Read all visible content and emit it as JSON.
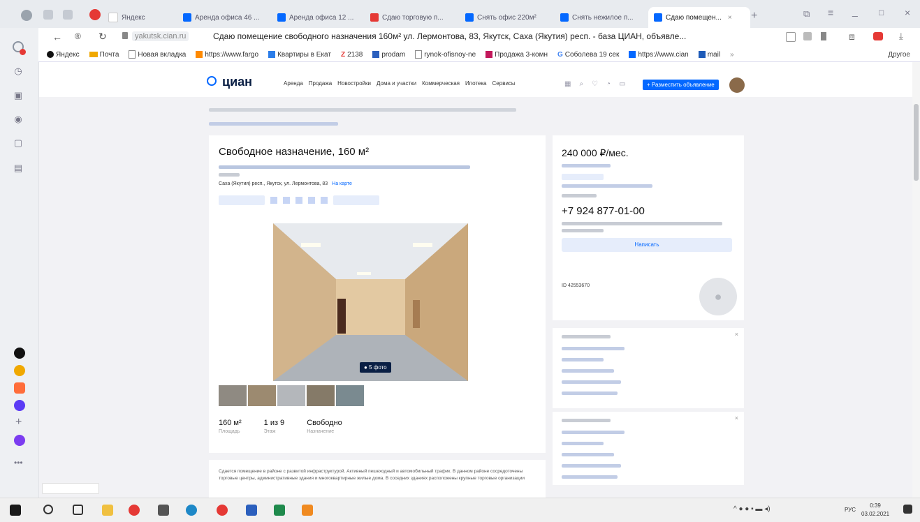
{
  "browser": {
    "tabs": [
      {
        "label": "Яндекс",
        "color": "#e53935"
      },
      {
        "label": "Аренда офиса 46 ...",
        "color": "#0468ff"
      },
      {
        "label": "Аренда офиса 12 ...",
        "color": "#0468ff"
      },
      {
        "label": "Сдаю торговую п...",
        "color": "#e53935"
      },
      {
        "label": "Снять офис 220м²",
        "color": "#0468ff"
      },
      {
        "label": "Снять нежилое п...",
        "color": "#0468ff"
      },
      {
        "label": "Сдаю помещен...",
        "color": "#0468ff"
      }
    ],
    "domain": "yakutsk.cian.ru",
    "page_title": "Сдаю помещение свободного назначения 160м² ул. Лермонтова, 83, Якутск, Саха (Якутия) респ. - база ЦИАН, объявле...",
    "bookmarks": [
      "Яндекс",
      "Почта",
      "Новая вкладка",
      "https://www.fargo",
      "Квартиры в Екат",
      "2138",
      "prodam",
      "rynok-ofisnoy-ne",
      "Продажа 3-комн",
      "Соболева 19 сек",
      "https://www.cian",
      "mail"
    ],
    "bookmarks_more": "Другое"
  },
  "cian": {
    "logo": "циан",
    "nav": [
      "Аренда",
      "Продажа",
      "Новостройки",
      "Дома и участки",
      "Коммерческая",
      "Ипотека",
      "Сервисы"
    ],
    "publish_button": "+ Разместить объявление",
    "title": "Свободное назначение, 160 м²",
    "address_line": "Саха (Якутия) респ., Якутск, ул. Лермонтова, 83",
    "address_link": "На карте",
    "photo_button": "5 фото",
    "stats": [
      {
        "value": "160 м²",
        "label": "Площадь"
      },
      {
        "value": "1 из 9",
        "label": "Этаж"
      },
      {
        "value": "Свободно",
        "label": "Назначение"
      }
    ],
    "price": "240 000 ₽/мес.",
    "phone": "+7 924 877-01-00",
    "write_button": "Написать",
    "listing_id": "ID 42553670",
    "description_start": "Сдается помещение в районе с развитой инфраструктурой. Активный пешеходный и автомобильный трафик. В данном районе сосредоточены торговые центры, административные здания и многоквартирные жилые дома. В соседних зданиях расположены крупные торговые организации"
  },
  "os": {
    "tray_lang": "РУС",
    "time": "0:39",
    "date": "03.02.2021"
  },
  "colors": {
    "brand": "#0468ff",
    "accent_red": "#e53935",
    "tab_bg": "#e8ebef",
    "page_bg": "#f2f2f5"
  }
}
